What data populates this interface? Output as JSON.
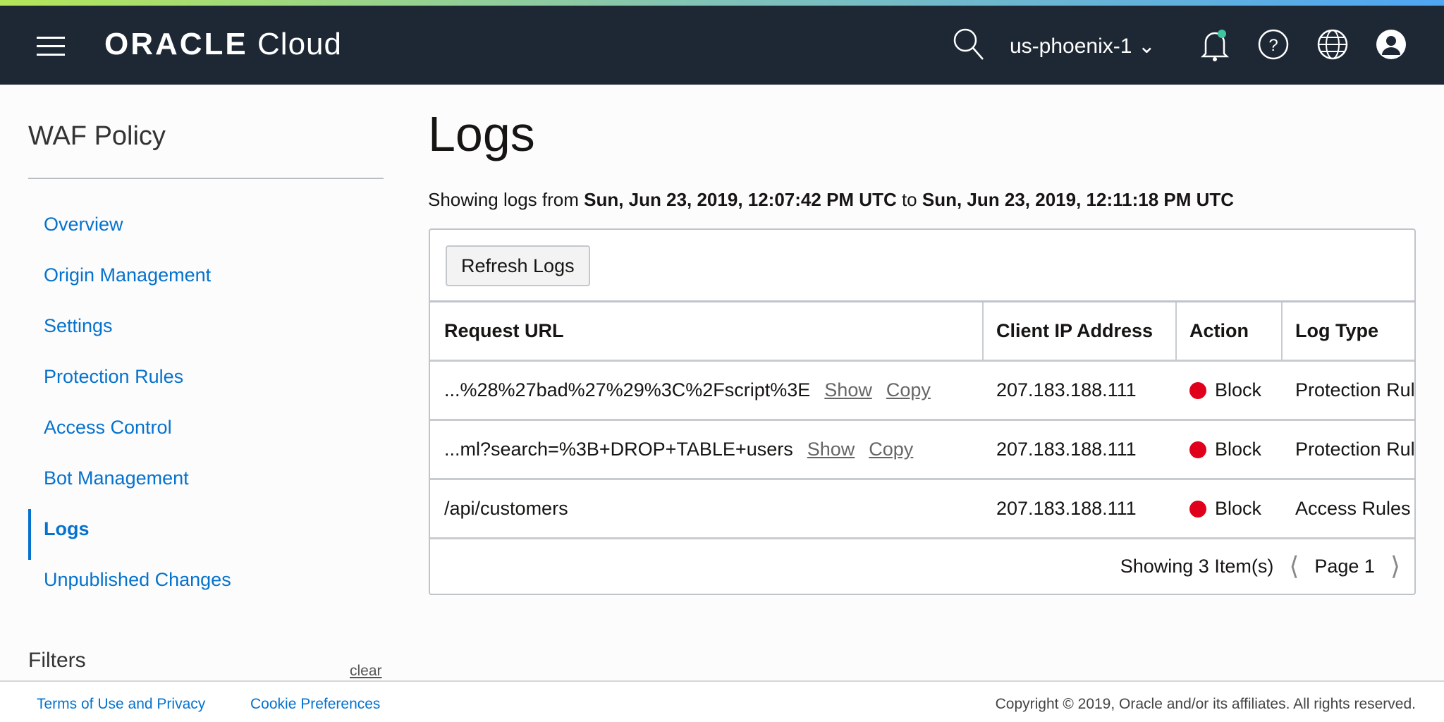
{
  "header": {
    "logo_brand": "ORACLE",
    "logo_product": "Cloud",
    "region": "us-phoenix-1"
  },
  "sidebar": {
    "title": "WAF Policy",
    "items": [
      {
        "label": "Overview"
      },
      {
        "label": "Origin Management"
      },
      {
        "label": "Settings"
      },
      {
        "label": "Protection Rules"
      },
      {
        "label": "Access Control"
      },
      {
        "label": "Bot Management"
      },
      {
        "label": "Logs",
        "active": true
      },
      {
        "label": "Unpublished Changes"
      }
    ],
    "filters_label": "Filters",
    "clear_label": "clear"
  },
  "main": {
    "title": "Logs",
    "sub_prefix": "Showing logs from ",
    "from": "Sun, Jun 23, 2019, 12:07:42 PM UTC",
    "sub_mid": " to ",
    "to": "Sun, Jun 23, 2019, 12:11:18 PM UTC",
    "refresh_label": "Refresh Logs",
    "columns": [
      "Request URL",
      "Client IP Address",
      "Action",
      "Log Type"
    ],
    "rows": [
      {
        "url": "...%28%27bad%27%29%3C%2Fscript%3E",
        "show": "Show",
        "copy": "Copy",
        "ip": "207.183.188.111",
        "action": "Block",
        "type": "Protection Rules"
      },
      {
        "url": "...ml?search=%3B+DROP+TABLE+users",
        "show": "Show",
        "copy": "Copy",
        "ip": "207.183.188.111",
        "action": "Block",
        "type": "Protection Rules"
      },
      {
        "url": "/api/customers",
        "ip": "207.183.188.111",
        "action": "Block",
        "type": "Access Rules"
      }
    ],
    "showing": "Showing 3 Item(s)",
    "page": "Page 1"
  },
  "footer": {
    "terms": "Terms of Use and Privacy",
    "cookies": "Cookie Preferences",
    "copyright": "Copyright © 2019, Oracle and/or its affiliates. All rights reserved."
  },
  "colors": {
    "header_bg": "#1e2835",
    "link": "#0572ce",
    "block": "#e0001b",
    "notify": "#3fc6a0"
  }
}
